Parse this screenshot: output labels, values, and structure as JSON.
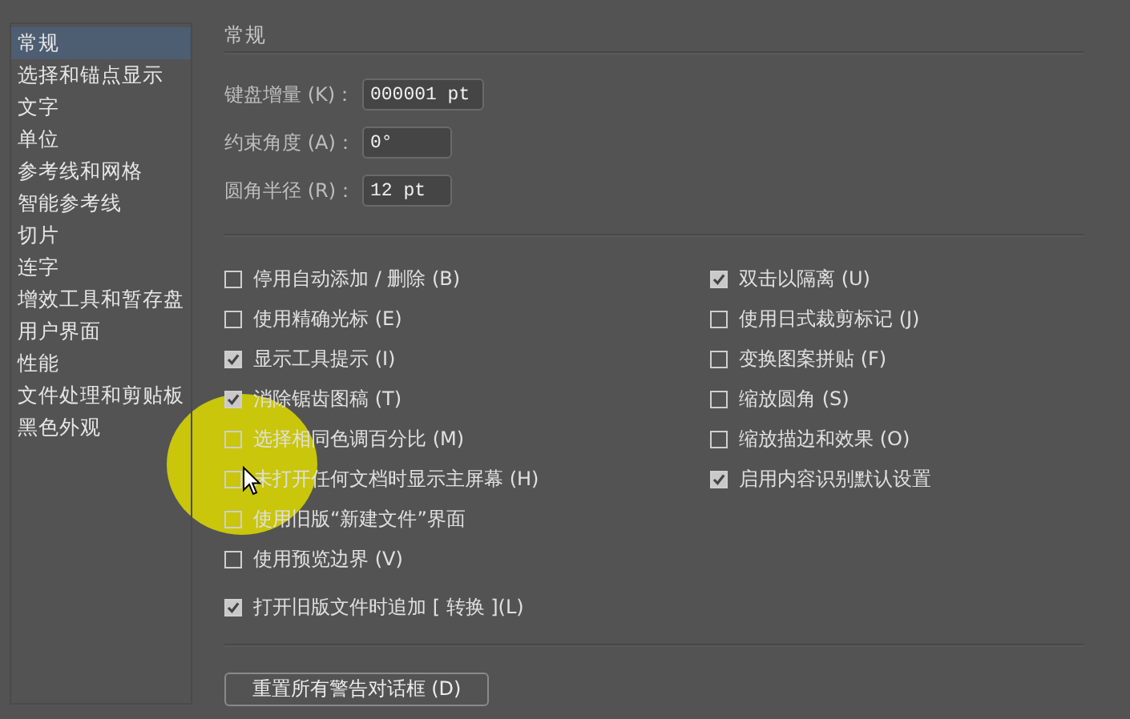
{
  "sidebar": {
    "items": [
      {
        "label": "常规",
        "selected": true
      },
      {
        "label": "选择和锚点显示",
        "selected": false
      },
      {
        "label": "文字",
        "selected": false
      },
      {
        "label": "单位",
        "selected": false
      },
      {
        "label": "参考线和网格",
        "selected": false
      },
      {
        "label": "智能参考线",
        "selected": false
      },
      {
        "label": "切片",
        "selected": false
      },
      {
        "label": "连字",
        "selected": false
      },
      {
        "label": "增效工具和暂存盘",
        "selected": false
      },
      {
        "label": "用户界面",
        "selected": false
      },
      {
        "label": "性能",
        "selected": false
      },
      {
        "label": "文件处理和剪贴板",
        "selected": false
      },
      {
        "label": "黑色外观",
        "selected": false
      }
    ]
  },
  "section_title": "常规",
  "fields": [
    {
      "label": "键盘增量 (K)：",
      "value": "000001 pt"
    },
    {
      "label": "约束角度 (A)：",
      "value": "0°"
    },
    {
      "label": "圆角半径 (R)：",
      "value": "12 pt"
    }
  ],
  "options_left": [
    {
      "label": "停用自动添加 / 删除 (B)",
      "checked": false
    },
    {
      "label": "使用精确光标 (E)",
      "checked": false
    },
    {
      "label": "显示工具提示 (I)",
      "checked": true
    },
    {
      "label": "消除锯齿图稿 (T)",
      "checked": true
    },
    {
      "label": "选择相同色调百分比 (M)",
      "checked": false
    },
    {
      "label": "未打开任何文档时显示主屏幕 (H)",
      "checked": false
    },
    {
      "label": "使用旧版“新建文件”界面",
      "checked": false
    },
    {
      "label": "使用预览边界 (V)",
      "checked": false
    }
  ],
  "option_bottom": {
    "label": "打开旧版文件时追加 [ 转换 ](L)",
    "checked": true
  },
  "options_right": [
    {
      "label": "双击以隔离 (U)",
      "checked": true
    },
    {
      "label": "使用日式裁剪标记 (J)",
      "checked": false
    },
    {
      "label": "变换图案拼贴 (F)",
      "checked": false
    },
    {
      "label": "缩放圆角 (S)",
      "checked": false
    },
    {
      "label": "缩放描边和效果 (O)",
      "checked": false
    },
    {
      "label": "启用内容识别默认设置",
      "checked": true
    }
  ],
  "reset_button": "重置所有警告对话框 (D)"
}
